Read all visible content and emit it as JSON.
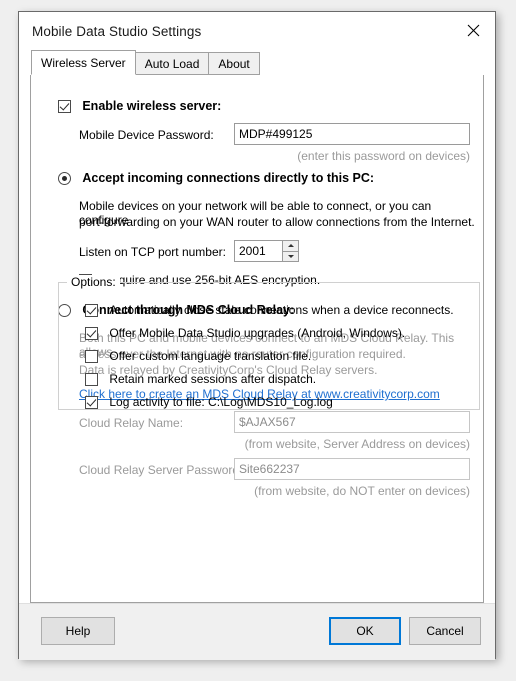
{
  "window": {
    "title": "Mobile Data Studio Settings",
    "close_icon": "close-icon"
  },
  "tabs": [
    {
      "label": "Wireless Server",
      "active": true
    },
    {
      "label": "Auto Load",
      "active": false
    },
    {
      "label": "About",
      "active": false
    }
  ],
  "wireless_server": {
    "enable_label": "Enable wireless server:",
    "enable_checked": true,
    "password_label": "Mobile Device Password:",
    "password_value": "MDP#499125",
    "password_hint": "(enter this password on devices)"
  },
  "direct": {
    "radio_label": "Accept incoming connections directly to this PC:",
    "selected": true,
    "desc_line1": "Mobile devices on your network will be able to connect, or you can configure",
    "desc_line2": "port-forwarding on your WAN router to allow connections from the Internet.",
    "port_label": "Listen on TCP port number:",
    "port_value": "2001",
    "encryption_label": "Require and use 256-bit AES encryption.",
    "encryption_checked": true
  },
  "cloud_relay": {
    "radio_label": "Connect through MDS Cloud Relay:",
    "selected": false,
    "desc_line1": "Both this PC and mobile devices connect to an MDS Cloud Relay.  This allows",
    "desc_line2": "access over the Internet with no router configuration required.",
    "desc_line3": "Data is relayed by CreativityCorp's Cloud Relay servers.",
    "link_text": "Click here to create an MDS Cloud Relay at www.creativitycorp.com",
    "name_label": "Cloud Relay Name:",
    "name_value": "$AJAX567",
    "name_hint": "(from website, Server Address on devices)",
    "server_password_label": "Cloud Relay Server Password:",
    "server_password_value": "Site662237",
    "server_password_hint": "(from website, do NOT enter on devices)"
  },
  "options": {
    "legend": "Options:",
    "items": [
      {
        "label": "Automatically close stale connections when a device reconnects.",
        "checked": true
      },
      {
        "label": "Offer Mobile Data Studio upgrades (Android, Windows).",
        "checked": true
      },
      {
        "label": "Offer custom language translation file.",
        "checked": false
      },
      {
        "label": "Retain marked sessions after dispatch.",
        "checked": false
      },
      {
        "label": "Log activity to file: C:\\Log\\MDS10_Log.log",
        "checked": true
      }
    ]
  },
  "buttons": {
    "help": "Help",
    "ok": "OK",
    "cancel": "Cancel"
  },
  "colors": {
    "link": "#1f6fd0",
    "focus_border": "#0078d7",
    "disabled_text": "#9a9a9a"
  }
}
